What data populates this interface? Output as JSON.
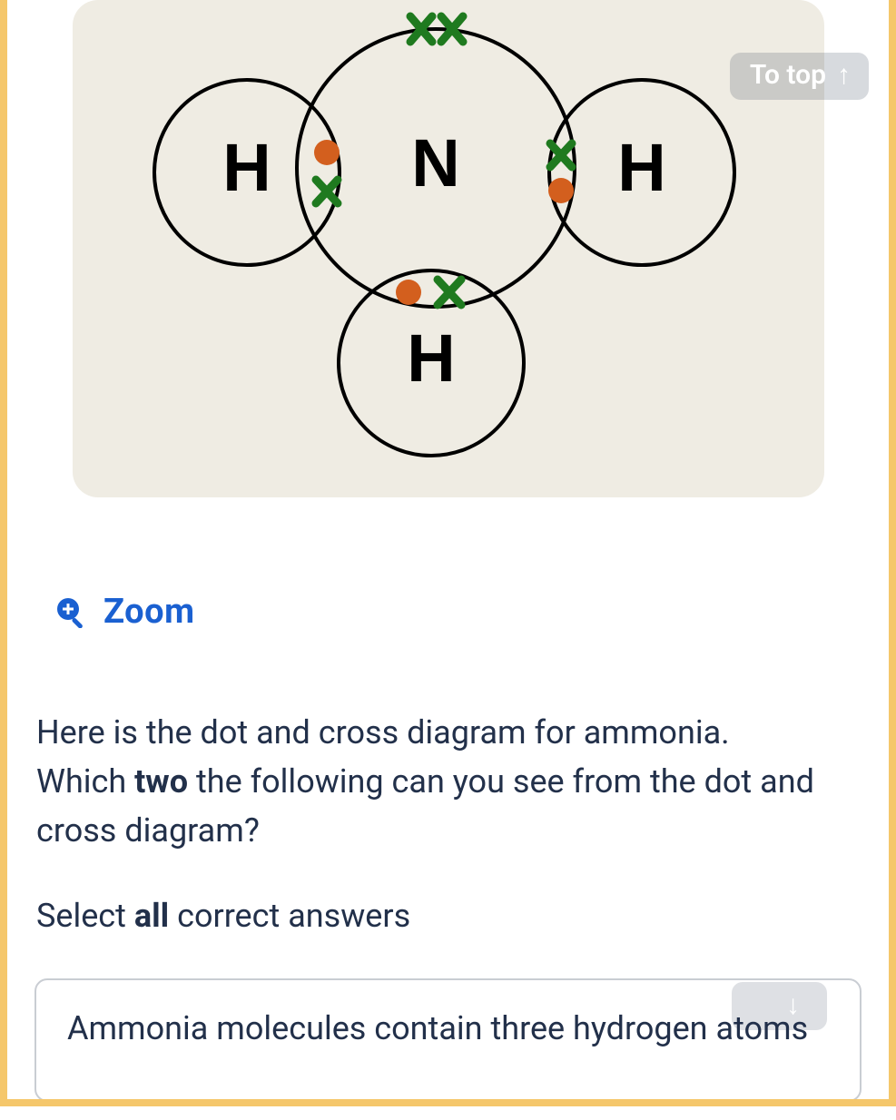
{
  "toTop": {
    "label": "To top"
  },
  "zoom": {
    "label": "Zoom"
  },
  "question": {
    "line1": "Here is the dot and cross diagram for ammonia.",
    "line2a": "Which ",
    "line2bold": "two",
    "line2b": " the following can you see from the dot and cross diagram?"
  },
  "instruction": {
    "prefix": "Select ",
    "bold": "all",
    "suffix": " correct answers"
  },
  "answers": [
    {
      "text": "Ammonia molecules contain three hydrogen atoms"
    }
  ],
  "diagram": {
    "atoms": {
      "center": "N",
      "left": "H",
      "right": "H",
      "bottom": "H"
    }
  }
}
